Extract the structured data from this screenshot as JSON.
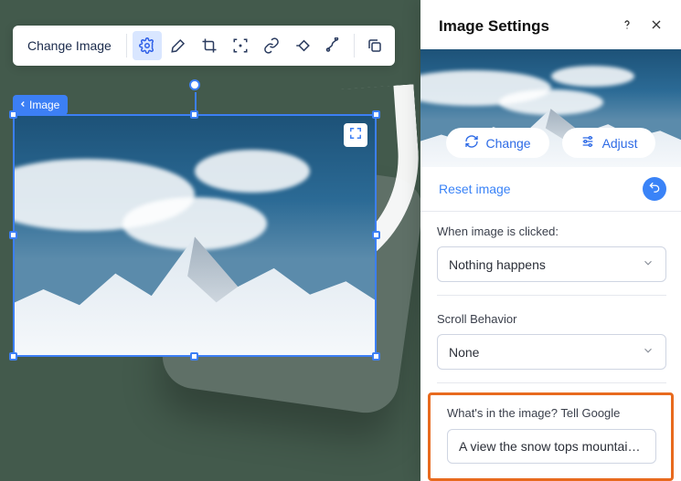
{
  "toolbar": {
    "change_image": "Change Image"
  },
  "breadcrumb": {
    "label": "Image"
  },
  "panel": {
    "title": "Image Settings",
    "change_btn": "Change",
    "adjust_btn": "Adjust",
    "reset_link": "Reset image",
    "click_section": {
      "label": "When image is clicked:",
      "value": "Nothing happens"
    },
    "scroll_section": {
      "label": "Scroll Behavior",
      "value": "None"
    },
    "alt_section": {
      "label": "What's in the image? Tell Google",
      "value": "A view the snow tops mountais, ever…"
    }
  }
}
